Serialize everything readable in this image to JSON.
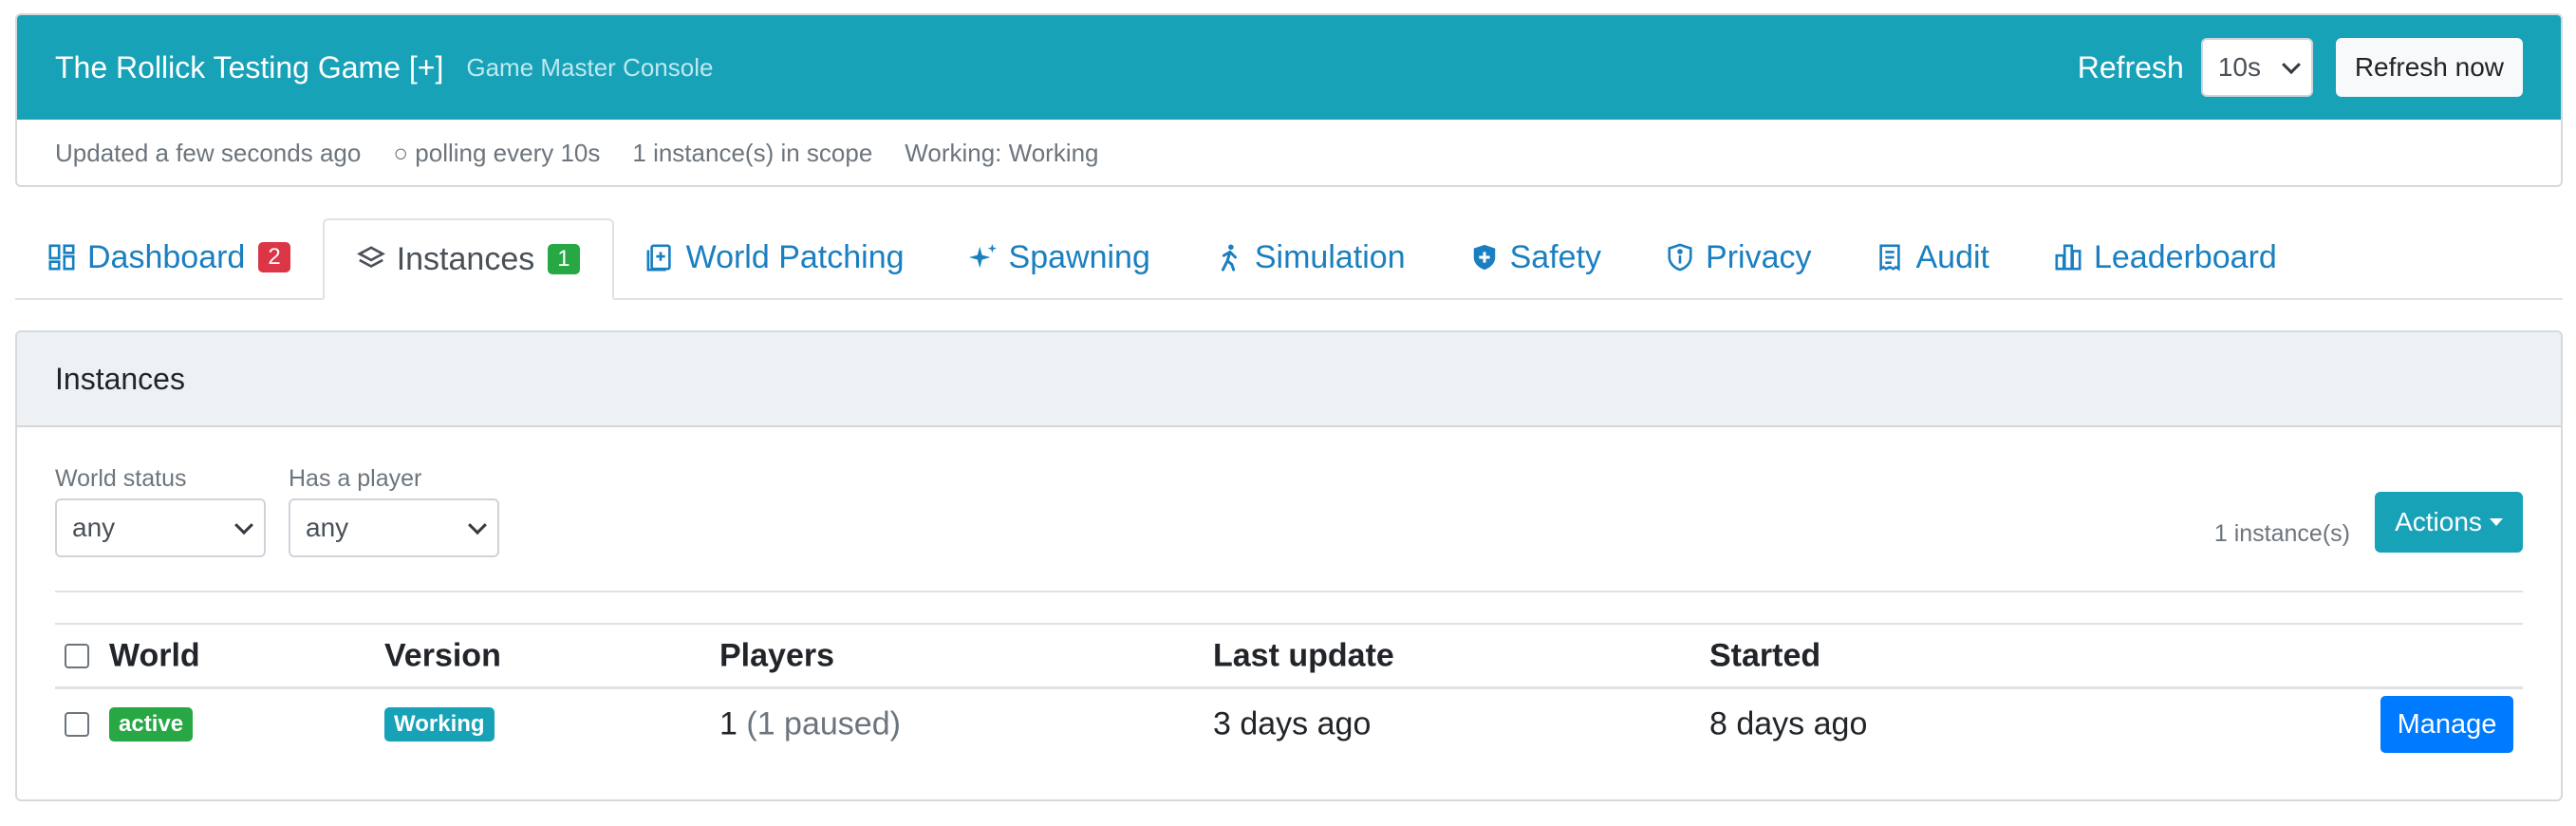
{
  "header": {
    "title": "The Rollick Testing Game [+]",
    "subtitle": "Game Master Console",
    "refresh_label": "Refresh",
    "refresh_interval": "10s",
    "refresh_now_label": "Refresh now"
  },
  "status": {
    "updated": "Updated a few seconds ago",
    "polling": "○ polling every 10s",
    "scope": "1 instance(s) in scope",
    "working": "Working: Working"
  },
  "tabs": [
    {
      "label": "Dashboard",
      "badge": "2",
      "icon": "dashboard-icon"
    },
    {
      "label": "Instances",
      "badge": "1",
      "icon": "layers-icon"
    },
    {
      "label": "World Patching",
      "icon": "patch-document-icon"
    },
    {
      "label": "Spawning",
      "icon": "sparkles-icon"
    },
    {
      "label": "Simulation",
      "icon": "person-walking-icon"
    },
    {
      "label": "Safety",
      "icon": "shield-plus-icon"
    },
    {
      "label": "Privacy",
      "icon": "shield-info-icon"
    },
    {
      "label": "Audit",
      "icon": "receipt-icon"
    },
    {
      "label": "Leaderboard",
      "icon": "bar-chart-icon"
    }
  ],
  "instances_panel": {
    "title": "Instances",
    "filters": {
      "world_status_label": "World status",
      "world_status_value": "any",
      "has_player_label": "Has a player",
      "has_player_value": "any"
    },
    "count_text": "1 instance(s)",
    "actions_label": "Actions",
    "table": {
      "columns": [
        "World",
        "Version",
        "Players",
        "Last update",
        "Started"
      ],
      "rows": [
        {
          "world_status": "active",
          "version": "Working",
          "players": "1",
          "players_paused": "(1 paused)",
          "last_update": "3 days ago",
          "started": "8 days ago",
          "action_label": "Manage"
        }
      ]
    }
  },
  "colors": {
    "header_bg": "#17a2b8",
    "link": "#1a7fc1",
    "primary": "#007bff",
    "success": "#28a745",
    "danger": "#dc3545"
  }
}
